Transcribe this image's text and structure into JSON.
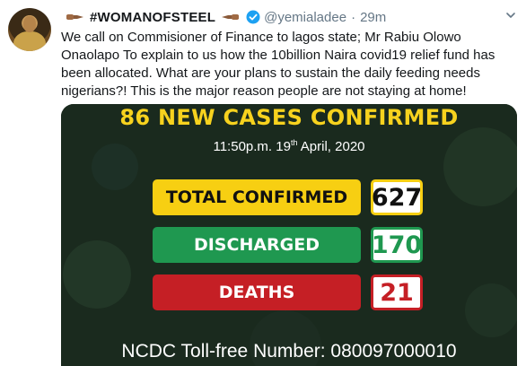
{
  "tweet": {
    "display_name": "#WOMANOFSTEEL",
    "handle": "@yemialadee",
    "separator": "·",
    "time": "29m",
    "text": "We call on Commisioner of Finance to lagos state; Mr Rabiu Olowo Onaolapo To explain to us how the 10billion Naira  covid19 relief fund has been allocated. What are your plans to sustain the daily feeding needs nigerians?! This is the major reason people are not staying at home!",
    "icons": [
      "hand-pointing-right-icon",
      "hand-pointing-left-icon",
      "verified-badge-icon",
      "chevron-down-icon"
    ]
  },
  "image": {
    "headline": "86 NEW CASES CONFIRMED",
    "time_text": "11:50p.m. 19",
    "date_suffix": "th",
    "date_rest": " April, 2020",
    "rows": [
      {
        "label": "TOTAL CONFIRMED",
        "value": "627",
        "color": "#f7cf12"
      },
      {
        "label": "DISCHARGED",
        "value": "170",
        "color": "#1f9850"
      },
      {
        "label": "DEATHS",
        "value": "21",
        "color": "#c51f25"
      }
    ],
    "tollfree": "NCDC Toll-free Number: 080097000010"
  },
  "colors": {
    "accent": "#1da1f2",
    "text": "#14171a",
    "muted": "#657786",
    "headline_yellow": "#f7d21e",
    "card_background": "#1a2b1f"
  }
}
